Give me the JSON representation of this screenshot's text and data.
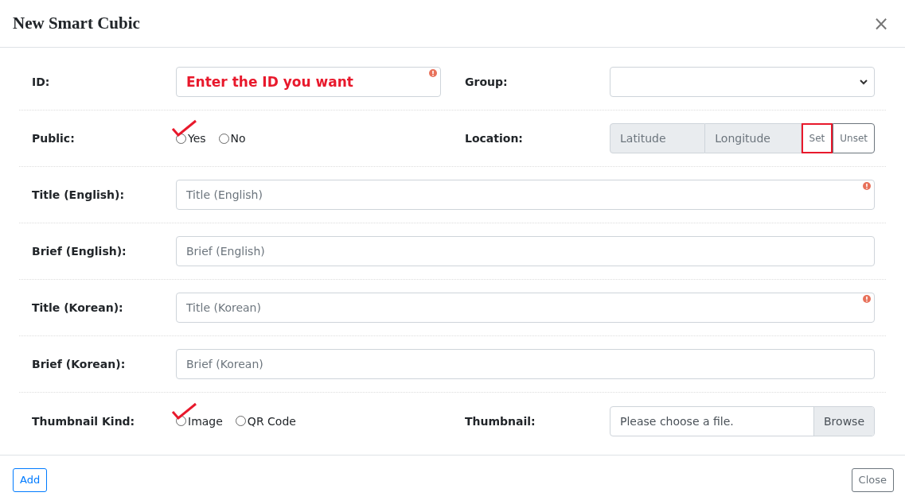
{
  "dialog": {
    "title": "New Smart Cubic",
    "close_label": "×"
  },
  "rows": [
    {
      "kind": "pair",
      "fields": [
        {
          "kind": "text",
          "label": "ID:",
          "value": "Enter the ID you want",
          "required": true
        },
        {
          "kind": "select",
          "label": "Group:"
        }
      ]
    },
    {
      "kind": "pair",
      "fields": [
        {
          "kind": "radios",
          "label": "Public:",
          "options": [
            {
              "label": "Yes",
              "selected": false,
              "marked": true
            },
            {
              "label": "No",
              "selected": false,
              "marked": false
            }
          ]
        },
        {
          "kind": "location",
          "label": "Location:",
          "latitude": "Latitude",
          "longitude": "Longitude",
          "buttons": [
            {
              "label": "Set",
              "highlighted": true
            },
            {
              "label": "Unset",
              "highlighted": false
            }
          ]
        }
      ]
    },
    {
      "kind": "full",
      "fields": [
        {
          "kind": "text",
          "label": "Title (English):",
          "placeholder": "Title (English)",
          "required": true
        }
      ]
    },
    {
      "kind": "full",
      "fields": [
        {
          "kind": "text",
          "label": "Brief (English):",
          "placeholder": "Brief (English)",
          "required": false
        }
      ]
    },
    {
      "kind": "full",
      "fields": [
        {
          "kind": "text",
          "label": "Title (Korean):",
          "placeholder": "Title (Korean)",
          "required": true
        }
      ]
    },
    {
      "kind": "full",
      "fields": [
        {
          "kind": "text",
          "label": "Brief (Korean):",
          "placeholder": "Brief (Korean)",
          "required": false
        }
      ]
    },
    {
      "kind": "pair",
      "fields": [
        {
          "kind": "radios",
          "label": "Thumbnail Kind:",
          "options": [
            {
              "label": "Image",
              "selected": false,
              "marked": true
            },
            {
              "label": "QR Code",
              "selected": false,
              "marked": false
            }
          ]
        },
        {
          "kind": "file",
          "label": "Thumbnail:",
          "placeholder": "Please choose a file.",
          "button": "Browse"
        }
      ]
    }
  ],
  "footer": {
    "primary": "Add",
    "secondary": "Close"
  }
}
